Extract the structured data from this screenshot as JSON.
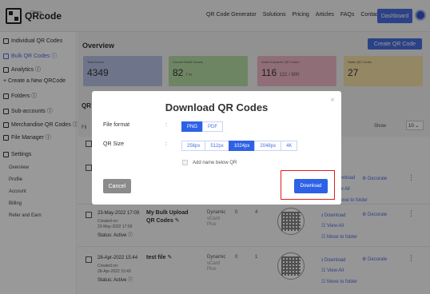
{
  "header": {
    "logo_text": "QRcode",
    "logo_sub": "Chimp",
    "nav": [
      "QR Code Generator",
      "Solutions",
      "Pricing",
      "Articles",
      "FAQs",
      "Contact Us"
    ],
    "dashboard_label": "Dashboard"
  },
  "sidebar": {
    "items": [
      {
        "label": "Individual QR Codes"
      },
      {
        "label": "Bulk QR Codes ⓘ"
      },
      {
        "label": "Analytics ⓘ"
      },
      {
        "label": "+ Create a New QRCode"
      },
      {
        "label": "Folders ⓘ"
      },
      {
        "label": "Sub-accounts ⓘ"
      },
      {
        "label": "Merchandise QR Codes ⓘ"
      },
      {
        "label": "File Manager ⓘ"
      },
      {
        "label": "Settings"
      }
    ],
    "settings_sub": [
      "Overview",
      "Profile",
      "Account",
      "Billing",
      "Refer and Earn"
    ]
  },
  "main": {
    "overview_title": "Overview",
    "create_btn": "Create QR Code",
    "stats": [
      {
        "label": "Total Scans",
        "value": "4349",
        "extra": "",
        "color": "#b8c3e6"
      },
      {
        "label": "Current Month Scans",
        "value": "82",
        "extra": "/ ∞",
        "color": "#b7dea5"
      },
      {
        "label": "Active Dynamic QR Codes",
        "value": "116",
        "extra": "121 / 800",
        "color": "#f1b8c7"
      },
      {
        "label": "Static QR Codes",
        "value": "27",
        "extra": "",
        "color": "#f6e2a7"
      }
    ],
    "section_label": "QR C",
    "filter_label": "Fil",
    "show_label": "Show",
    "show_value": "10",
    "rows": [
      {
        "date": "23-May-2022 17:09",
        "created_label": "Created on:",
        "created": "23-May-2022 17:09",
        "status": "Status: Active ⓘ",
        "name": "My Bulk Upload QR Codes ✎",
        "type": "Dynamic",
        "subtype": "vCard",
        "plan": "Plus",
        "n1": "0",
        "n2": "4"
      },
      {
        "date": "28-Apr-2022 15:44",
        "created_label": "Created on:",
        "created": "28-Apr-2022 15:43",
        "status": "Status: Active ⓘ",
        "name": "test file ✎",
        "type": "Dynamic",
        "subtype": "vCard",
        "plan": "Plus",
        "n1": "0",
        "n2": "1"
      }
    ],
    "actions": {
      "download": "⭳ Download",
      "decorate": "⚙ Decorate",
      "view_all": "☷ View All",
      "move": "☷ Move to folder",
      "partial_download": "ownload",
      "partial_view": "ew All",
      "partial_move": "Move to folder"
    }
  },
  "modal": {
    "title": "Download QR Codes",
    "close": "×",
    "format_label": "File format",
    "formats": [
      "PNG",
      "PDF"
    ],
    "format_selected": "PNG",
    "size_label": "QR Size",
    "sizes": [
      "256px",
      "512px",
      "1024px",
      "2048px",
      "4K"
    ],
    "size_selected": "1024px",
    "colon": ":",
    "add_name_label": "Add name below QR",
    "cancel": "Cancel",
    "download": "Download"
  }
}
